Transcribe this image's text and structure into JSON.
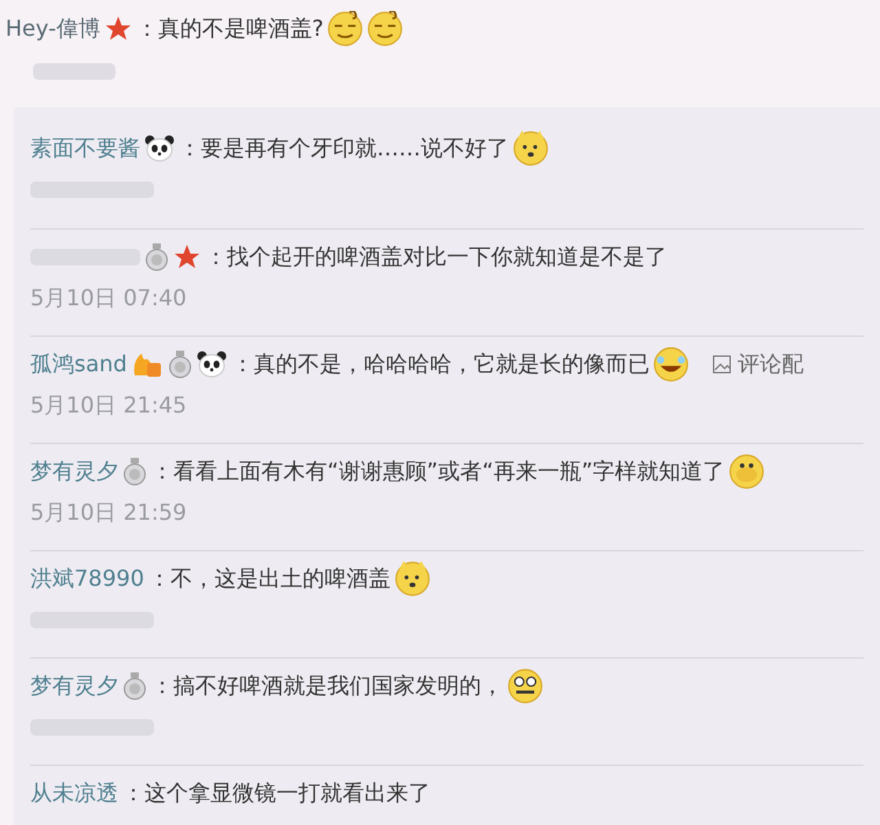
{
  "root": {
    "user": "Hey-偉博",
    "badges": [
      {
        "kind": "star"
      }
    ],
    "separator": "：",
    "text": "真的不是啤酒盖?",
    "emojis": [
      {
        "kind": "dizzy"
      },
      {
        "kind": "dizzy"
      }
    ]
  },
  "replies": [
    {
      "user": "素面不要酱",
      "badges": [
        {
          "kind": "panda"
        }
      ],
      "text": "要是再有个牙印就……说不好了",
      "emojis": [
        {
          "kind": "dog"
        }
      ]
    },
    {
      "badges": [
        {
          "kind": "medal"
        },
        {
          "kind": "star"
        }
      ],
      "text": "找个起开的啤酒盖对比一下你就知道是不是了",
      "time": "5月10日 07:40"
    },
    {
      "user": "孤鸿sand",
      "badges": [
        {
          "kind": "vip"
        },
        {
          "kind": "medal"
        },
        {
          "kind": "panda"
        }
      ],
      "text": "真的不是，哈哈哈哈，它就是长的像而已",
      "emojis": [
        {
          "kind": "laugh"
        }
      ],
      "time": "5月10日 21:45",
      "action": "评论配"
    },
    {
      "user": "梦有灵夕",
      "badges": [
        {
          "kind": "medal"
        }
      ],
      "text": "看看上面有木有“谢谢惠顾”或者“再来一瓶”字样就知道了",
      "emojis": [
        {
          "kind": "cover"
        }
      ],
      "time": "5月10日 21:59"
    },
    {
      "user": "洪斌78990",
      "text": "不，这是出土的啤酒盖",
      "emojis": [
        {
          "kind": "dog"
        }
      ]
    },
    {
      "user": "梦有灵夕",
      "badges": [
        {
          "kind": "medal"
        }
      ],
      "text": "搞不好啤酒就是我们国家发明的，",
      "emojis": [
        {
          "kind": "shock"
        }
      ]
    },
    {
      "user": "从未凉透",
      "text": "这个拿显微镜一打就看出来了"
    }
  ]
}
